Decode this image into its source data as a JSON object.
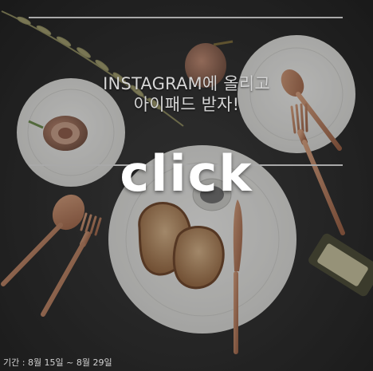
{
  "banner": {
    "headline_line1": "INSTAGRAM에 올리고",
    "headline_line2": "아이패드 받자!",
    "cta_label": "click",
    "period_text": "기간 : 8월 15일 ~ 8월 29일"
  },
  "colors": {
    "background": "#262626",
    "plate": "#e6e6e4",
    "copper": "#b87a5a",
    "rule": "#a9a9a9"
  }
}
